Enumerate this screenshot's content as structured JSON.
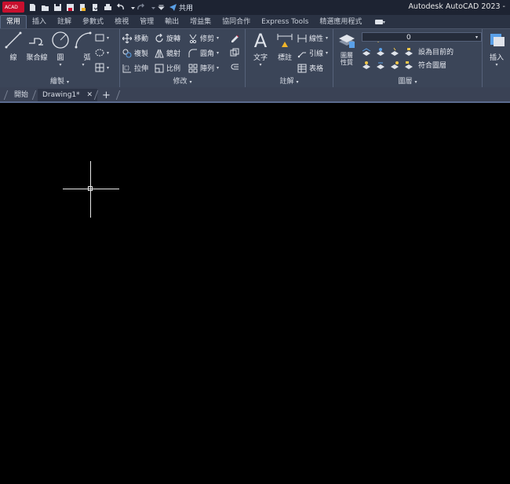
{
  "app": {
    "logo_main": "A",
    "logo_sub": "CAD",
    "title": "Autodesk AutoCAD 2023 -",
    "share_label": "共用"
  },
  "ribbon_tabs": [
    "常用",
    "插入",
    "註解",
    "參數式",
    "檢視",
    "管理",
    "輸出",
    "增益集",
    "協同合作",
    "Express Tools",
    "精選應用程式"
  ],
  "panels": {
    "draw": {
      "title": "繪製",
      "line": "線",
      "polyline": "聚合線",
      "circle": "圓",
      "arc": "弧"
    },
    "modify": {
      "title": "修改",
      "move": "移動",
      "rotate": "旋轉",
      "trim": "修剪",
      "copy": "複製",
      "mirror": "鏡射",
      "fillet": "圓角",
      "stretch": "拉伸",
      "scale": "比例",
      "array": "陣列"
    },
    "annotation": {
      "title": "註解",
      "text": "文字",
      "dimension": "標註",
      "linear": "線性",
      "leader": "引線",
      "table": "表格"
    },
    "layers": {
      "title": "圖層",
      "layer_props_line1": "圖層",
      "layer_props_line2": "性質",
      "current_layer": "0",
      "make_current": "設為目前的",
      "match_layer": "符合圖層"
    },
    "block": {
      "insert": "插入"
    }
  },
  "doc_tabs": {
    "start": "開始",
    "drawing": "Drawing1*"
  },
  "colors": {
    "titlebar": "#1d2332",
    "ribbon": "#3b4558",
    "canvas": "#000000",
    "accent_red": "#c8102e"
  }
}
